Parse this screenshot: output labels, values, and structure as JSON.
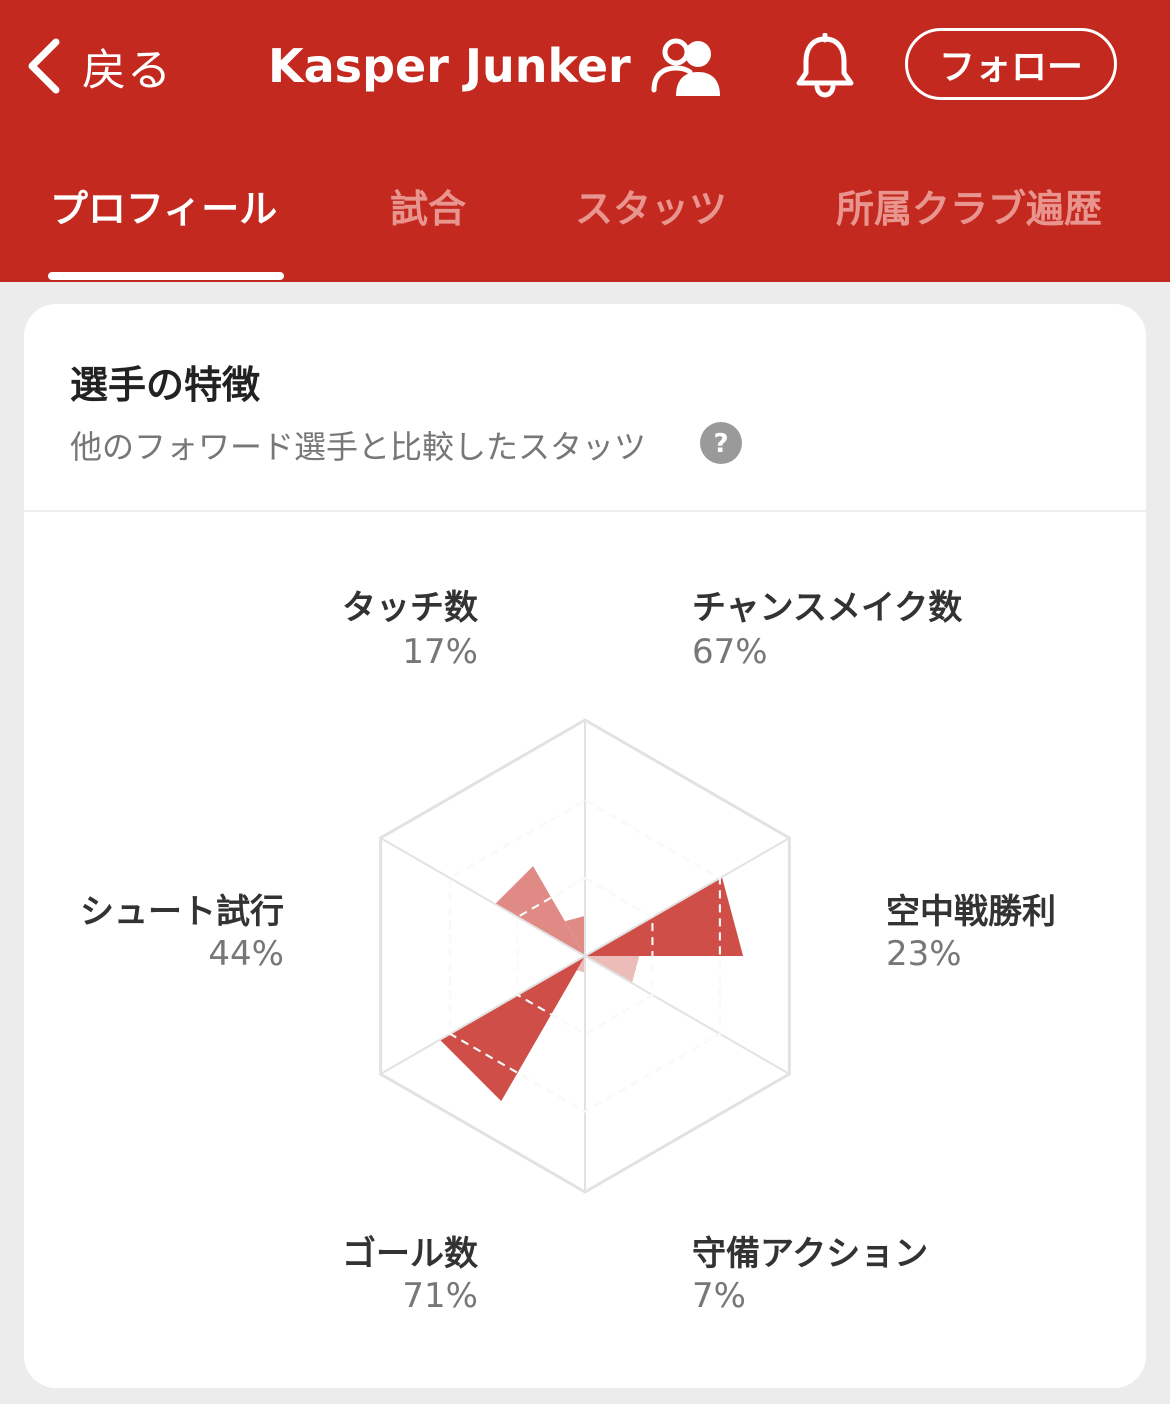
{
  "header": {
    "back_label": "戻る",
    "player_name": "Kasper Junker",
    "follow_label": "フォロー",
    "bg_color": "#c4291f"
  },
  "icons": {
    "back": "chevron-left-icon",
    "people": "people-icon",
    "bell": "bell-icon",
    "help": "question-icon"
  },
  "tabs": [
    {
      "label": "プロフィール",
      "active": true
    },
    {
      "label": "試合",
      "active": false
    },
    {
      "label": "スタッツ",
      "active": false
    },
    {
      "label": "所属クラブ遍歴",
      "active": false
    }
  ],
  "card": {
    "title": "選手の特徴",
    "subtitle": "他のフォワード選手と比較したスタッツ"
  },
  "chart_data": {
    "type": "radar",
    "axes": [
      {
        "label": "タッチ数",
        "value": 17,
        "display": "17%"
      },
      {
        "label": "チャンスメイク数",
        "value": 67,
        "display": "67%"
      },
      {
        "label": "空中戦勝利",
        "value": 23,
        "display": "23%"
      },
      {
        "label": "守備アクション",
        "value": 7,
        "display": "7%"
      },
      {
        "label": "ゴール数",
        "value": 71,
        "display": "71%"
      },
      {
        "label": "シュート試行",
        "value": 44,
        "display": "44%"
      }
    ],
    "range": [
      0,
      100
    ],
    "grid_levels": [
      33,
      66,
      100
    ],
    "colors": {
      "strong": "#cf4e47",
      "light": "#e08a86",
      "lighter": "#ecbcb9",
      "grid": "#e2e2e2"
    }
  }
}
